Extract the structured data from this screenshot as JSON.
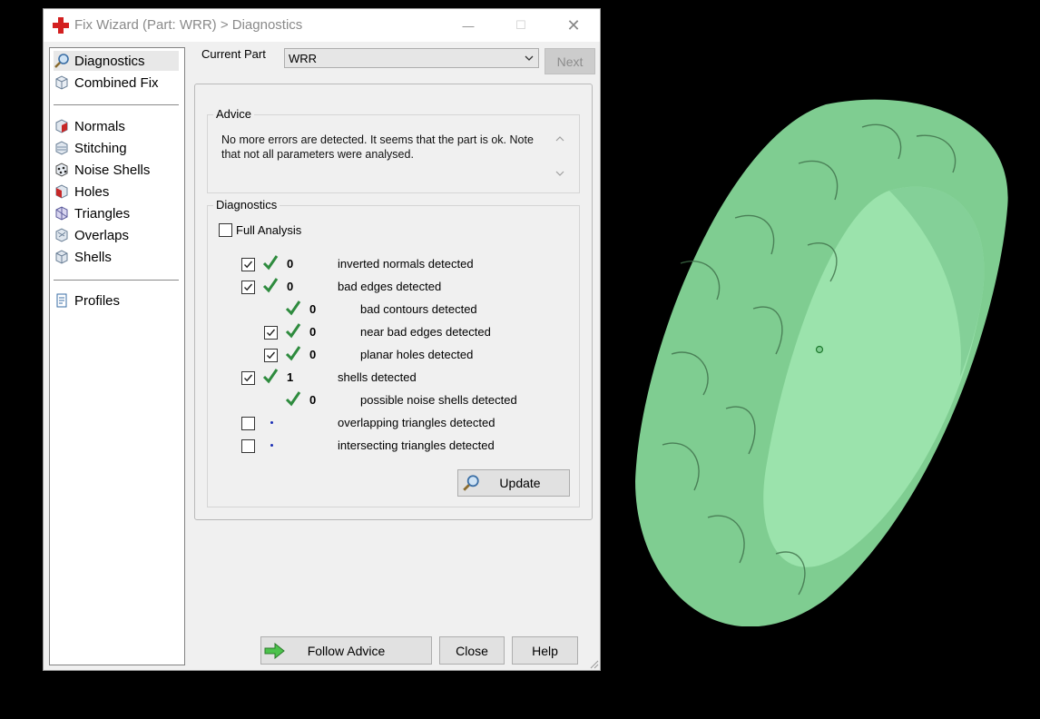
{
  "window": {
    "title": "Fix Wizard (Part: WRR) > Diagnostics",
    "min_glyph": "—",
    "max_glyph": "☐",
    "close_glyph": "✕"
  },
  "sidebar": {
    "items": [
      {
        "label": "Diagnostics",
        "icon": "magnifier-icon",
        "selected": true
      },
      {
        "label": "Combined Fix",
        "icon": "cube-icon"
      },
      {
        "label": "Normals",
        "icon": "normals-cube-icon"
      },
      {
        "label": "Stitching",
        "icon": "stitching-cube-icon"
      },
      {
        "label": "Noise Shells",
        "icon": "noise-shells-icon"
      },
      {
        "label": "Holes",
        "icon": "holes-cube-icon"
      },
      {
        "label": "Triangles",
        "icon": "triangles-cube-icon"
      },
      {
        "label": "Overlaps",
        "icon": "overlaps-cube-icon"
      },
      {
        "label": "Shells",
        "icon": "shells-cube-icon"
      },
      {
        "label": "Profiles",
        "icon": "profiles-document-icon"
      }
    ]
  },
  "current_part": {
    "label": "Current Part",
    "value": "WRR",
    "next_label": "Next"
  },
  "advice": {
    "title": "Advice",
    "text": "No more errors are detected. It seems that the part is ok. Note that not all parameters were analysed."
  },
  "diagnostics": {
    "title": "Diagnostics",
    "full_analysis_label": "Full Analysis",
    "full_analysis_checked": false,
    "rows": [
      {
        "checkbox": true,
        "checked": true,
        "status": "ok",
        "value": "0",
        "label": "inverted normals detected",
        "indent": 0
      },
      {
        "checkbox": true,
        "checked": true,
        "status": "ok",
        "value": "0",
        "label": "bad edges detected",
        "indent": 0
      },
      {
        "checkbox": false,
        "checked": false,
        "status": "ok",
        "value": "0",
        "label": "bad contours detected",
        "indent": 1
      },
      {
        "checkbox": true,
        "checked": true,
        "status": "ok",
        "value": "0",
        "label": "near bad edges detected",
        "indent": 1
      },
      {
        "checkbox": true,
        "checked": true,
        "status": "ok",
        "value": "0",
        "label": "planar holes detected",
        "indent": 1
      },
      {
        "checkbox": true,
        "checked": true,
        "status": "ok",
        "value": "1",
        "label": "shells detected",
        "indent": 0
      },
      {
        "checkbox": false,
        "checked": false,
        "status": "ok",
        "value": "0",
        "label": "possible noise shells detected",
        "indent": 1
      },
      {
        "checkbox": true,
        "checked": false,
        "status": "none",
        "value": "",
        "label": "overlapping triangles detected",
        "indent": 0
      },
      {
        "checkbox": true,
        "checked": false,
        "status": "none",
        "value": "",
        "label": "intersecting triangles detected",
        "indent": 0
      }
    ],
    "update_label": "Update"
  },
  "footer": {
    "follow_advice_label": "Follow Advice",
    "close_label": "Close",
    "help_label": "Help"
  },
  "colors": {
    "ok_tick": "#2e8b3e",
    "ring": "#8fd9a2",
    "background": "#000000"
  }
}
